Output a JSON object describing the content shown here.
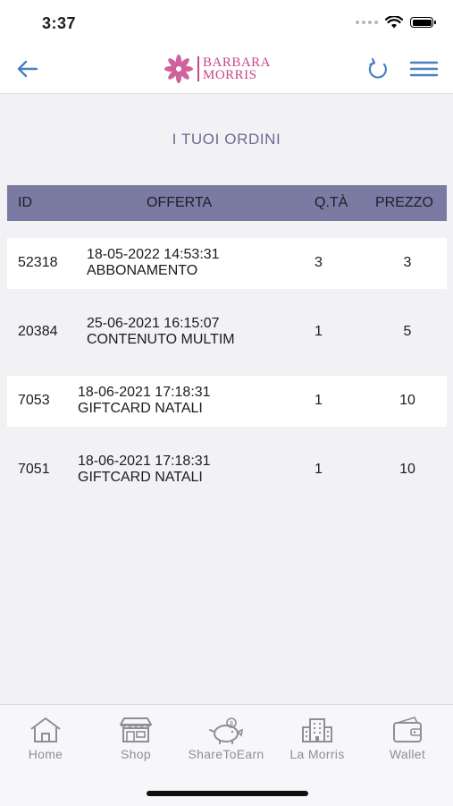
{
  "status_bar": {
    "time": "3:37"
  },
  "header": {
    "logo_line1": "BARBARA",
    "logo_line2": "MORRIS",
    "back_icon": "back-arrow-icon",
    "refresh_icon": "refresh-icon",
    "menu_icon": "hamburger-menu-icon"
  },
  "page": {
    "title": "I TUOI ORDINI"
  },
  "table": {
    "columns": [
      "ID",
      "OFFERTA",
      "Q.TÀ",
      "PREZZO"
    ],
    "rows": [
      {
        "id": "52318",
        "date": "18-05-2022 14:53:31",
        "offer": "ABBONAMENTO",
        "qty": "3",
        "price": "3"
      },
      {
        "id": "20384",
        "date": "25-06-2021 16:15:07",
        "offer": "CONTENUTO MULTIM",
        "qty": "1",
        "price": "5"
      },
      {
        "id": "7053",
        "date": "18-06-2021 17:18:31",
        "offer": "GIFTCARD NATALI",
        "qty": "1",
        "price": "10"
      },
      {
        "id": "7051",
        "date": "18-06-2021 17:18:31",
        "offer": "GIFTCARD NATALI",
        "qty": "1",
        "price": "10"
      }
    ]
  },
  "tab_bar": {
    "tabs": [
      {
        "label": "Home",
        "icon": "home-icon"
      },
      {
        "label": "Shop",
        "icon": "shop-icon"
      },
      {
        "label": "ShareToEarn",
        "icon": "piggy-bank-icon"
      },
      {
        "label": "La Morris",
        "icon": "building-icon"
      },
      {
        "label": "Wallet",
        "icon": "wallet-icon"
      }
    ]
  },
  "colors": {
    "accent": "#4a7fc1",
    "brand": "#c8478a",
    "table_header": "#7b7aa3",
    "title": "#6b6a93"
  }
}
